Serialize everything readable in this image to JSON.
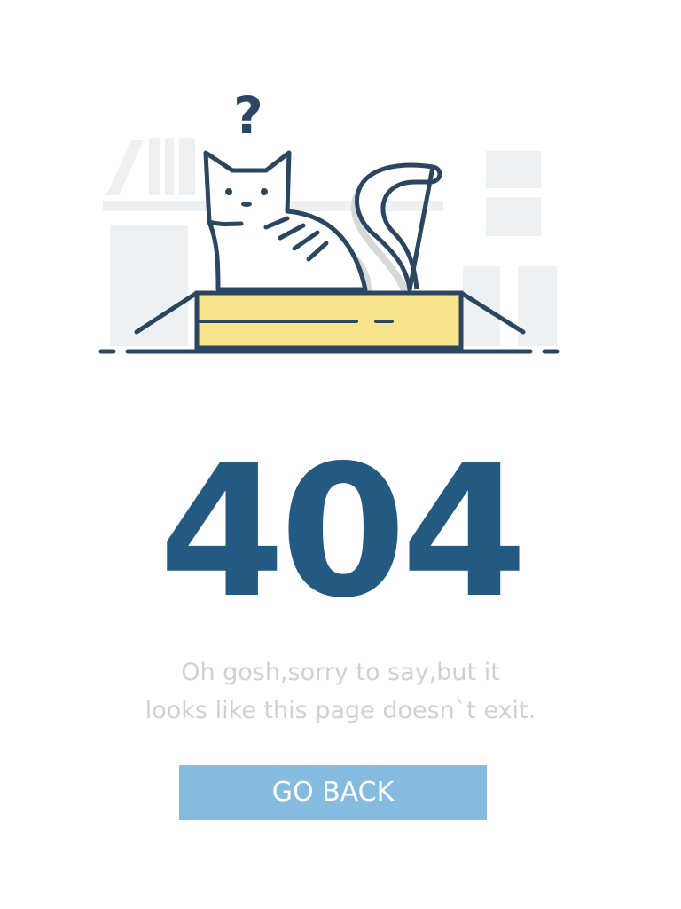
{
  "error": {
    "code": "404",
    "message_line1": "Oh gosh,sorry to say,but it",
    "message_line2": "looks like this page doesn`t exit."
  },
  "actions": {
    "go_back_label": "GO BACK"
  },
  "illustration": {
    "question_mark": "?"
  },
  "colors": {
    "code": "#245a82",
    "message": "#d0d0d0",
    "button_bg": "#86bbe0",
    "button_text": "#ffffff",
    "outline": "#2b4660",
    "box_fill": "#f8e48c",
    "background_shapes": "#eef1f4"
  }
}
